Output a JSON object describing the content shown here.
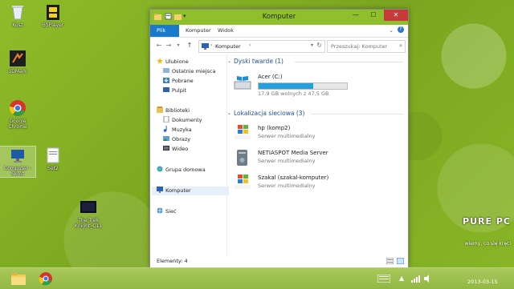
{
  "desktop": {
    "icons": [
      {
        "label": "Kosz"
      },
      {
        "label": "BSPlayer"
      },
      {
        "label": "3DMark"
      },
      {
        "label": "Google Chrome"
      },
      {
        "label": "Computer - Skrót"
      },
      {
        "label": "Set2"
      },
      {
        "label": "The Trek Knight_C11"
      }
    ]
  },
  "window": {
    "title": "Komputer",
    "tabs": [
      {
        "label": "Plik"
      },
      {
        "label": "Komputer"
      },
      {
        "label": "Widok"
      }
    ],
    "address": {
      "segment": "Komputer"
    },
    "search": {
      "placeholder": "Przeszukaj: Komputer"
    },
    "nav": {
      "favorites": {
        "label": "Ulubione",
        "items": [
          "Ostatnie miejsca",
          "Pobrane",
          "Pulpit"
        ]
      },
      "libraries": {
        "label": "Biblioteki",
        "items": [
          "Dokumenty",
          "Muzyka",
          "Obrazy",
          "Wideo"
        ]
      },
      "homegroup": "Grupa domowa",
      "computer": "Komputer",
      "network": "Sieć"
    },
    "groups": {
      "drives": {
        "label": "Dyski twarde (1)"
      },
      "network": {
        "label": "Lokalizacja sieciowa (3)"
      }
    },
    "drive": {
      "name": "Acer (C:)",
      "space": "17,9 GB wolnych z 47,5 GB",
      "used_fraction": 0.62
    },
    "network_items": [
      {
        "name": "hp (komp2)",
        "type": "Serwer multimedialny"
      },
      {
        "name": "NETIASPOT Media Server",
        "type": "Serwer multimedialny"
      },
      {
        "name": "Szakal (szakal-komputer)",
        "type": "Serwer multimedialny"
      }
    ],
    "status": "Elementy: 4"
  },
  "clock": {
    "date": "2013-03-15"
  },
  "watermark": {
    "brand": "PURE PC",
    "tagline": "wiemy, co się kręci"
  }
}
